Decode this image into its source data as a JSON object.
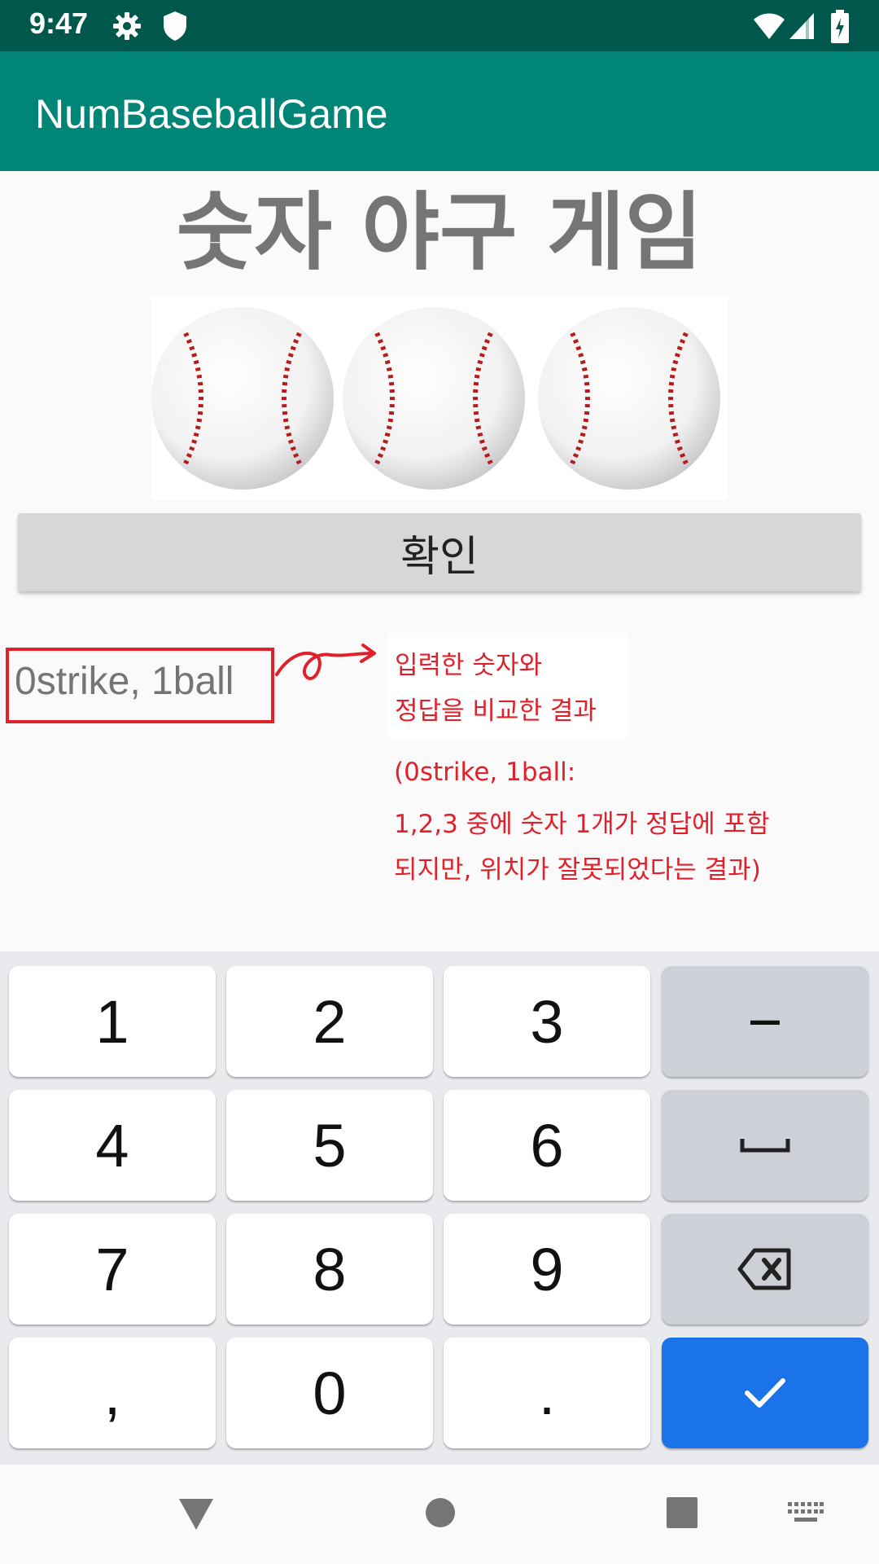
{
  "status_bar": {
    "time": "9:47",
    "icons": [
      "gear-icon",
      "shield-icon",
      "wifi-icon",
      "signal-icon",
      "battery-icon"
    ]
  },
  "app_bar": {
    "title": "NumBaseballGame",
    "color": "#008577"
  },
  "main": {
    "heading": "숫자 야구 게임",
    "balls_image": "baseball-balls-image",
    "confirm_label": "확인",
    "result_text": "0strike, 1ball",
    "note_lines": [
      "입력한 숫자와",
      "정답을 비교한 결과"
    ],
    "explain_lines": [
      "(0strike, 1ball:",
      "1,2,3 중에 숫자 1개가 정답에 포함",
      "되지만, 위치가 잘못되었다는 결과)"
    ],
    "annotation_color": "#e0202a"
  },
  "keyboard": {
    "rows": [
      [
        "1",
        "2",
        "3",
        "−"
      ],
      [
        "4",
        "5",
        "6",
        "space-icon"
      ],
      [
        "7",
        "8",
        "9",
        "backspace-icon"
      ],
      [
        ",",
        "0",
        ".",
        "checkmark-icon"
      ]
    ],
    "done_color": "#1a73e8"
  },
  "nav_bar": {
    "buttons": [
      "back-icon",
      "home-icon",
      "recents-icon",
      "keyboard-switch-icon"
    ]
  }
}
